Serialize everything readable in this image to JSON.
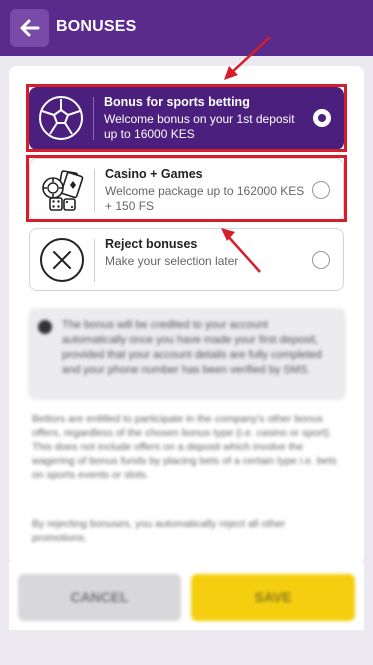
{
  "header": {
    "title": "BONUSES"
  },
  "options": [
    {
      "title": "Bonus for sports betting",
      "description": "Welcome bonus on your 1st deposit up to 16000 KES",
      "selected": true,
      "icon": "soccer-ball-icon"
    },
    {
      "title": "Casino + Games",
      "description": "Welcome package up to 162000 KES + 150 FS",
      "selected": false,
      "icon": "casino-chips-dice-icon"
    },
    {
      "title": "Reject bonuses",
      "description": "Make your selection later",
      "selected": false,
      "icon": "cross-circle-icon"
    }
  ],
  "info_text": "The bonus will be credited to your account automatically once you have made your first deposit, provided that your account details are fully completed and your phone number has been verified by SMS.",
  "notes": [
    "Bettors are entitled to participate in the company's other bonus offers, regardless of the chosen bonus type (i.e. casino or sport). This does not include offers on a deposit which involve the wagering of bonus funds by placing bets of a certain type i.e. bets on sports events or slots.",
    "By rejecting bonuses, you automatically reject all other promotions."
  ],
  "buttons": {
    "cancel": "CANCEL",
    "save": "SAVE"
  },
  "colors": {
    "header_bg": "#5a2a8c",
    "selected_bg": "#4a1f7e",
    "highlight": "#d51e2a",
    "save_bg": "#f5cf0f"
  }
}
